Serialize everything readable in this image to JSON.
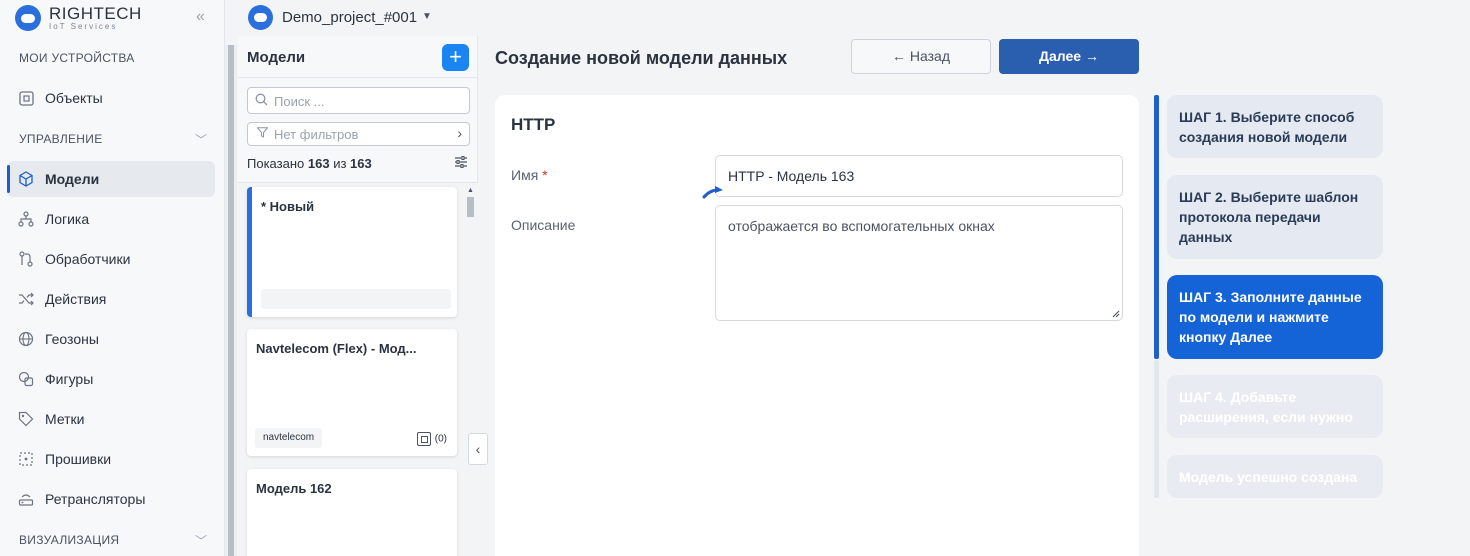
{
  "brand": {
    "name": "RIGHTECH",
    "tagline": "IoT Services"
  },
  "project": {
    "name": "Demo_project_#001"
  },
  "sidebar": {
    "section_devices": "МОИ УСТРОЙСТВА",
    "section_manage": "УПРАВЛЕНИЕ",
    "section_visual": "ВИЗУАЛИЗАЦИЯ",
    "items": [
      {
        "label": "Объекты",
        "icon": "object-icon"
      },
      {
        "label": "Модели",
        "icon": "cube-icon",
        "active": true
      },
      {
        "label": "Логика",
        "icon": "logic-icon"
      },
      {
        "label": "Обработчики",
        "icon": "handler-icon"
      },
      {
        "label": "Действия",
        "icon": "shuffle-icon"
      },
      {
        "label": "Геозоны",
        "icon": "globe-icon"
      },
      {
        "label": "Фигуры",
        "icon": "shapes-icon"
      },
      {
        "label": "Метки",
        "icon": "tag-icon"
      },
      {
        "label": "Прошивки",
        "icon": "firmware-icon"
      },
      {
        "label": "Ретрансляторы",
        "icon": "relay-icon"
      }
    ]
  },
  "models": {
    "title": "Модели",
    "search_placeholder": "Поиск ...",
    "filter_placeholder": "Нет фильтров",
    "shown_prefix": "Показано",
    "shown_count": "163",
    "shown_of": "из",
    "shown_total": "163",
    "cards": [
      {
        "title": "* Новый",
        "tag": "",
        "devices": ""
      },
      {
        "title": "Navtelecom (Flex) - Мод...",
        "tag": "navtelecom",
        "devices": "(0)"
      },
      {
        "title": "Модель 162",
        "tag": "",
        "devices": ""
      }
    ]
  },
  "main": {
    "title": "Создание новой модели данных",
    "back_label": "← Назад",
    "next_label": "Далее →",
    "form": {
      "protocol": "HTTP",
      "name_label": "Имя",
      "name_required": "*",
      "name_value": "HTTP - Модель 163",
      "desc_label": "Описание",
      "desc_value": "отображается во вспомогательных окнах"
    }
  },
  "steps": [
    {
      "label": "ШАГ 1. Выберите способ создания новой модели",
      "state": "done"
    },
    {
      "label": "ШАГ 2. Выберите шаблон протокола передачи данных",
      "state": "done"
    },
    {
      "label": "ШАГ 3. Заполните данные по модели и нажмите кнопку Далее",
      "state": "active"
    },
    {
      "label": "ШАГ 4. Добавьте расширения, если нужно",
      "state": "disabled"
    },
    {
      "label": "Модель успешно создана",
      "state": "disabled"
    }
  ]
}
